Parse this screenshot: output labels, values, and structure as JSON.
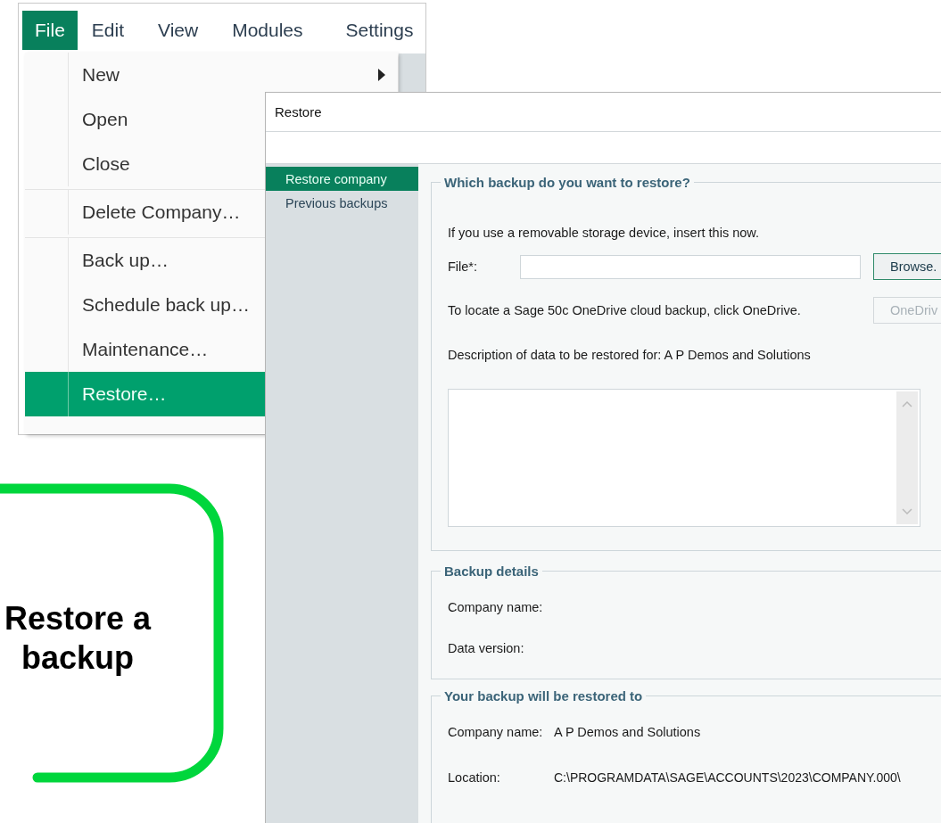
{
  "menu_bar": [
    {
      "label": "File",
      "selected": true
    },
    {
      "label": "Edit",
      "selected": false
    },
    {
      "label": "View",
      "selected": false
    },
    {
      "label": "Modules",
      "selected": false
    },
    {
      "label": "Settings",
      "selected": false
    }
  ],
  "file_menu": {
    "groups": [
      [
        {
          "label": "New",
          "submenu": true,
          "selected": false
        },
        {
          "label": "Open",
          "selected": false
        },
        {
          "label": "Close",
          "selected": false
        }
      ],
      [
        {
          "label": "Delete Company…",
          "selected": false
        }
      ],
      [
        {
          "label": "Back up…",
          "selected": false
        },
        {
          "label": "Schedule back up…",
          "selected": false
        },
        {
          "label": "Maintenance…",
          "selected": false
        },
        {
          "label": "Restore…",
          "selected": true
        }
      ]
    ]
  },
  "dialog": {
    "title": "Restore",
    "sidebar": [
      {
        "label": "Restore company",
        "selected": true
      },
      {
        "label": "Previous backups",
        "selected": false
      }
    ],
    "which_backup": {
      "legend": "Which backup do you want to restore?",
      "hint": "If you use a removable storage device, insert this now.",
      "file_label": "File*:",
      "browse_button": {
        "label": "Browse.",
        "disabled": false
      },
      "onedrive_text": "To locate a Sage 50c OneDrive cloud backup, click OneDrive.",
      "onedrive_button": {
        "label": "OneDriv",
        "disabled": true
      },
      "description_label": "Description of data to be restored for: A P Demos and Solutions"
    },
    "backup_details": {
      "legend": "Backup details",
      "rows": [
        {
          "label": "Company name:"
        },
        {
          "label": "Data version:"
        }
      ]
    },
    "restored_to": {
      "legend": "Your backup will be restored to",
      "rows": [
        {
          "label": "Company name:",
          "value": "A P Demos and Solutions"
        },
        {
          "label": "Location:",
          "value": "C:\\PROGRAMDATA\\SAGE\\ACCOUNTS\\2023\\COMPANY.000\\"
        }
      ]
    }
  },
  "callout": {
    "lines": [
      "Restore a",
      "backup"
    ]
  }
}
